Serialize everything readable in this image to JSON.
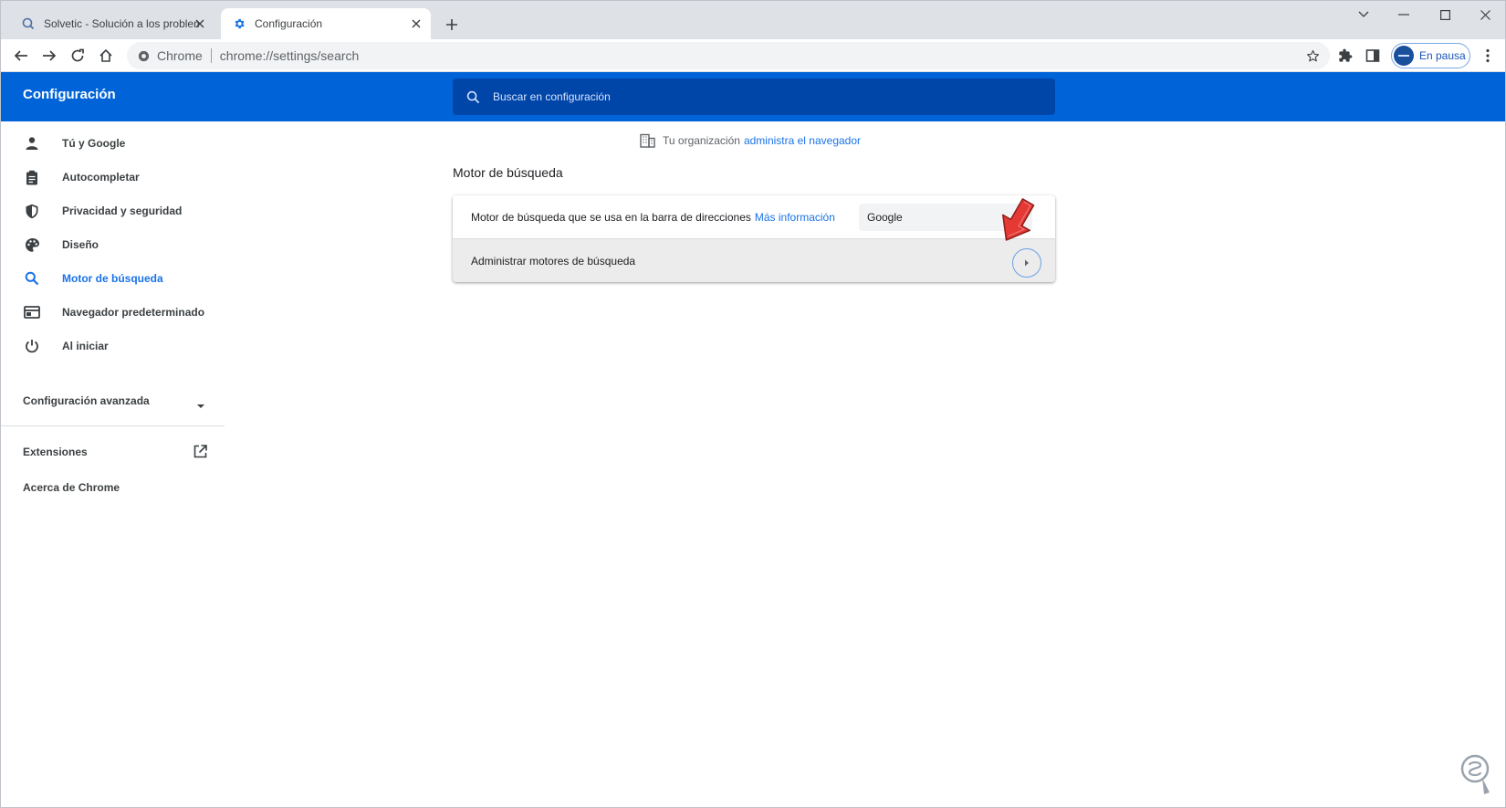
{
  "browser": {
    "tabs": [
      {
        "title": "Solvetic - Solución a los problem",
        "icon": "solvetic-favicon"
      },
      {
        "title": "Configuración",
        "icon": "gear-icon"
      }
    ],
    "omnibox": {
      "site_label": "Chrome",
      "url": "chrome://settings/search"
    },
    "profile_label": "En pausa"
  },
  "settings": {
    "title": "Configuración",
    "search_placeholder": "Buscar en configuración"
  },
  "sidebar": {
    "items": [
      {
        "label": "Tú y Google",
        "icon": "person-icon"
      },
      {
        "label": "Autocompletar",
        "icon": "clipboard-icon"
      },
      {
        "label": "Privacidad y seguridad",
        "icon": "shield-icon"
      },
      {
        "label": "Diseño",
        "icon": "palette-icon"
      },
      {
        "label": "Motor de búsqueda",
        "icon": "search-icon"
      },
      {
        "label": "Navegador predeterminado",
        "icon": "browser-icon"
      },
      {
        "label": "Al iniciar",
        "icon": "power-icon"
      }
    ],
    "advanced_label": "Configuración avanzada",
    "extensions_label": "Extensiones",
    "about_label": "Acerca de Chrome"
  },
  "main": {
    "managed_text": "Tu organización",
    "managed_link": "administra el navegador",
    "section_title": "Motor de búsqueda",
    "engine_label": "Motor de búsqueda que se usa en la barra de direcciones",
    "engine_link": "Más información",
    "engine_value": "Google",
    "manage_label": "Administrar motores de búsqueda"
  },
  "colors": {
    "header": "#0063d8",
    "accent": "#1a73e8",
    "pointer": "#e53935"
  }
}
